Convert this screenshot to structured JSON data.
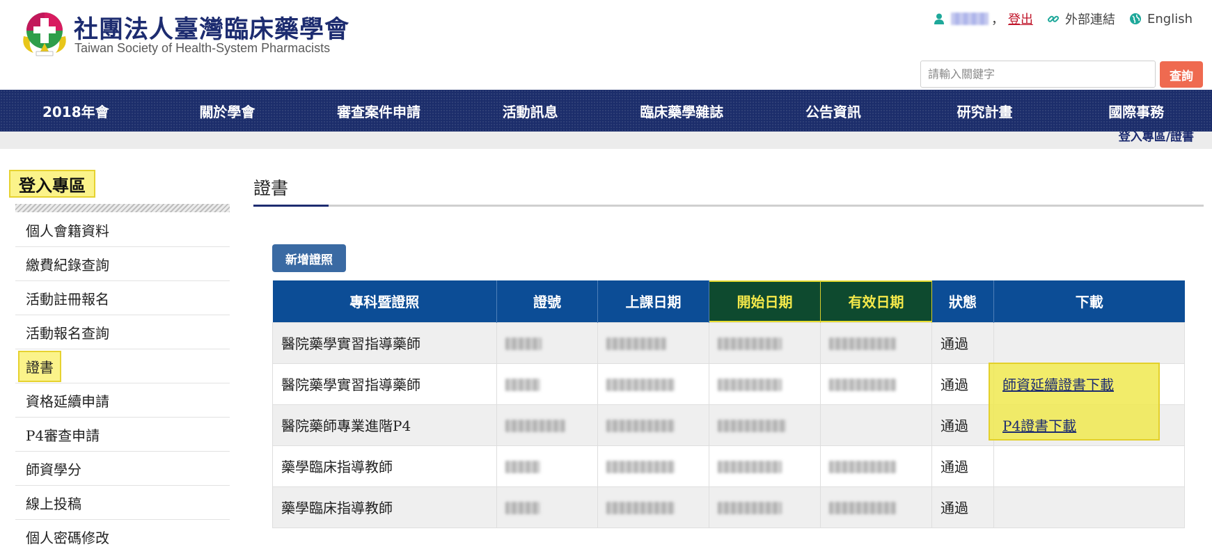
{
  "header": {
    "org_name_cn": "社團法人臺灣臨床藥學會",
    "org_name_en": "Taiwan Society of Health-System Pharmacists",
    "user_icon": "user-icon",
    "comma": "，",
    "logout": "登出",
    "external_links": "外部連結",
    "language": "English",
    "search_placeholder": "請輸入關鍵字",
    "search_button": "查詢"
  },
  "nav": {
    "items": [
      "2018年會",
      "關於學會",
      "審查案件申請",
      "活動訊息",
      "臨床藥學雜誌",
      "公告資訊",
      "研究計畫",
      "國際事務"
    ]
  },
  "breadcrumb": "登入專區/證書",
  "sidebar": {
    "title": "登入專區",
    "items": [
      "個人會籍資料",
      "繳費紀錄查詢",
      "活動註冊報名",
      "活動報名查詢",
      "證書",
      "資格延續申請",
      "P4審查申請",
      "師資學分",
      "線上投稿",
      "個人密碼修改"
    ]
  },
  "main": {
    "title": "證書",
    "add_button": "新增證照",
    "table": {
      "headers": [
        "專科暨證照",
        "證號",
        "上課日期",
        "開始日期",
        "有效日期",
        "狀態",
        "下載"
      ],
      "rows": [
        {
          "name": "醫院藥學實習指導藥師",
          "status": "通過",
          "download": ""
        },
        {
          "name": "醫院藥學實習指導藥師",
          "status": "通過",
          "download": "師資延續證書下載"
        },
        {
          "name": "醫院藥師專業進階P4",
          "status": "通過",
          "download": "P4證書下載"
        },
        {
          "name": "藥學臨床指導教師",
          "status": "通過",
          "download": ""
        },
        {
          "name": "藥學臨床指導教師",
          "status": "通過",
          "download": ""
        }
      ]
    }
  },
  "colors": {
    "nav_bg": "#1c2d6b",
    "table_header": "#0c4d96",
    "highlight": "#fbf38a",
    "search_button": "#ef6a50",
    "logout": "#c0152a"
  }
}
